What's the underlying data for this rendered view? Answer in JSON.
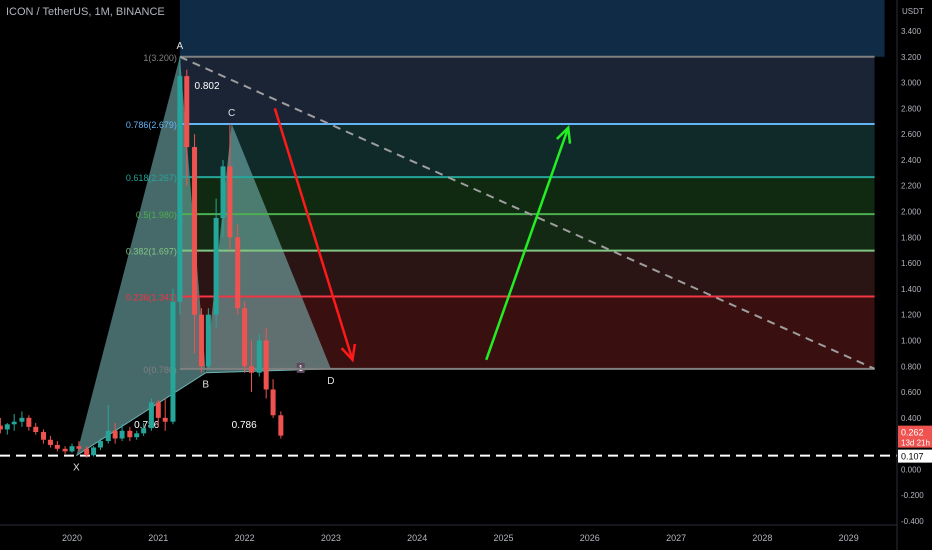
{
  "header": {
    "symbol": "ICON / TetherUS",
    "interval": "1M",
    "exchange": "BINANCE"
  },
  "price_axis": {
    "currency": "USDT",
    "current_price": "0.262",
    "countdown": "13d 21h",
    "dashed_level": "0.107"
  },
  "chart_data": {
    "type": "candlestick",
    "y_ticks": [
      "-0.400",
      "-0.200",
      "0.000",
      "0.200",
      "0.400",
      "0.600",
      "0.800",
      "1.000",
      "1.200",
      "1.400",
      "1.600",
      "1.800",
      "2.000",
      "2.200",
      "2.400",
      "2.600",
      "2.800",
      "3.000",
      "3.200",
      "3.400"
    ],
    "x_ticks": [
      "2020",
      "2021",
      "2022",
      "2023",
      "2024",
      "2025",
      "2026",
      "2027",
      "2028",
      "2029"
    ],
    "ylim": [
      -0.43,
      3.6
    ],
    "x_start": 2019.17,
    "candles": [
      {
        "t": 2019.17,
        "o": 0.34,
        "h": 0.4,
        "l": 0.28,
        "c": 0.31
      },
      {
        "t": 2019.25,
        "o": 0.31,
        "h": 0.36,
        "l": 0.27,
        "c": 0.35
      },
      {
        "t": 2019.33,
        "o": 0.35,
        "h": 0.43,
        "l": 0.3,
        "c": 0.37
      },
      {
        "t": 2019.42,
        "o": 0.37,
        "h": 0.45,
        "l": 0.33,
        "c": 0.4
      },
      {
        "t": 2019.5,
        "o": 0.4,
        "h": 0.42,
        "l": 0.3,
        "c": 0.33
      },
      {
        "t": 2019.58,
        "o": 0.33,
        "h": 0.36,
        "l": 0.27,
        "c": 0.29
      },
      {
        "t": 2019.67,
        "o": 0.29,
        "h": 0.31,
        "l": 0.2,
        "c": 0.23
      },
      {
        "t": 2019.75,
        "o": 0.23,
        "h": 0.26,
        "l": 0.17,
        "c": 0.19
      },
      {
        "t": 2019.83,
        "o": 0.19,
        "h": 0.22,
        "l": 0.14,
        "c": 0.16
      },
      {
        "t": 2019.92,
        "o": 0.16,
        "h": 0.18,
        "l": 0.12,
        "c": 0.14
      },
      {
        "t": 2020.0,
        "o": 0.14,
        "h": 0.2,
        "l": 0.13,
        "c": 0.18
      },
      {
        "t": 2020.08,
        "o": 0.18,
        "h": 0.22,
        "l": 0.14,
        "c": 0.16
      },
      {
        "t": 2020.17,
        "o": 0.16,
        "h": 0.18,
        "l": 0.09,
        "c": 0.11
      },
      {
        "t": 2020.25,
        "o": 0.11,
        "h": 0.18,
        "l": 0.1,
        "c": 0.17
      },
      {
        "t": 2020.33,
        "o": 0.17,
        "h": 0.24,
        "l": 0.15,
        "c": 0.22
      },
      {
        "t": 2020.42,
        "o": 0.22,
        "h": 0.5,
        "l": 0.2,
        "c": 0.3
      },
      {
        "t": 2020.5,
        "o": 0.3,
        "h": 0.36,
        "l": 0.2,
        "c": 0.24
      },
      {
        "t": 2020.58,
        "o": 0.24,
        "h": 0.35,
        "l": 0.22,
        "c": 0.3
      },
      {
        "t": 2020.67,
        "o": 0.3,
        "h": 0.33,
        "l": 0.22,
        "c": 0.25
      },
      {
        "t": 2020.75,
        "o": 0.25,
        "h": 0.3,
        "l": 0.23,
        "c": 0.28
      },
      {
        "t": 2020.83,
        "o": 0.28,
        "h": 0.36,
        "l": 0.26,
        "c": 0.32
      },
      {
        "t": 2020.92,
        "o": 0.32,
        "h": 0.55,
        "l": 0.3,
        "c": 0.52
      },
      {
        "t": 2021.0,
        "o": 0.52,
        "h": 0.54,
        "l": 0.33,
        "c": 0.4
      },
      {
        "t": 2021.08,
        "o": 0.4,
        "h": 0.55,
        "l": 0.3,
        "c": 0.37
      },
      {
        "t": 2021.17,
        "o": 0.37,
        "h": 1.4,
        "l": 0.35,
        "c": 1.3
      },
      {
        "t": 2021.25,
        "o": 1.3,
        "h": 3.2,
        "l": 1.2,
        "c": 3.05
      },
      {
        "t": 2021.33,
        "o": 3.05,
        "h": 3.1,
        "l": 2.2,
        "c": 2.5
      },
      {
        "t": 2021.42,
        "o": 2.5,
        "h": 2.6,
        "l": 0.9,
        "c": 1.2
      },
      {
        "t": 2021.5,
        "o": 1.2,
        "h": 1.25,
        "l": 0.75,
        "c": 0.8
      },
      {
        "t": 2021.58,
        "o": 0.8,
        "h": 1.25,
        "l": 0.78,
        "c": 1.2
      },
      {
        "t": 2021.67,
        "o": 1.2,
        "h": 2.1,
        "l": 1.1,
        "c": 1.95
      },
      {
        "t": 2021.75,
        "o": 1.95,
        "h": 2.4,
        "l": 1.8,
        "c": 2.35
      },
      {
        "t": 2021.83,
        "o": 2.35,
        "h": 2.68,
        "l": 1.7,
        "c": 1.8
      },
      {
        "t": 2021.92,
        "o": 1.8,
        "h": 1.9,
        "l": 1.2,
        "c": 1.25
      },
      {
        "t": 2022.0,
        "o": 1.25,
        "h": 1.3,
        "l": 0.75,
        "c": 0.8
      },
      {
        "t": 2022.08,
        "o": 0.8,
        "h": 1.0,
        "l": 0.6,
        "c": 0.75
      },
      {
        "t": 2022.17,
        "o": 0.75,
        "h": 1.05,
        "l": 0.72,
        "c": 1.0
      },
      {
        "t": 2022.25,
        "o": 1.0,
        "h": 1.1,
        "l": 0.55,
        "c": 0.62
      },
      {
        "t": 2022.33,
        "o": 0.62,
        "h": 0.7,
        "l": 0.4,
        "c": 0.42
      },
      {
        "t": 2022.42,
        "o": 0.42,
        "h": 0.45,
        "l": 0.24,
        "c": 0.262
      }
    ],
    "xabcd": {
      "points": [
        {
          "name": "X",
          "t": 2020.05,
          "v": 0.107
        },
        {
          "name": "A",
          "t": 2021.25,
          "v": 3.2
        },
        {
          "name": "B",
          "t": 2021.55,
          "v": 0.75
        },
        {
          "name": "C",
          "t": 2021.85,
          "v": 2.68
        },
        {
          "name": "D",
          "t": 2023.0,
          "v": 0.78
        }
      ],
      "ratio_xb": "0.786",
      "ratio_ac": "0.802",
      "ratio_bd": "0.786",
      "unreadable_label": "1"
    },
    "fib_levels": [
      {
        "ratio": "1(3.200)",
        "value": 3.2,
        "color": "#808080",
        "fill": "#1c1c1c"
      },
      {
        "ratio": "0.786(2.679)",
        "value": 2.679,
        "color": "#64b5f6",
        "fill": "#1a2434"
      },
      {
        "ratio": "0.618(2.267)",
        "value": 2.267,
        "color": "#26a69a",
        "fill": "#102a2a"
      },
      {
        "ratio": "0.5(1.980)",
        "value": 1.98,
        "color": "#4caf50",
        "fill": "#0f2a10"
      },
      {
        "ratio": "0.382(1.697)",
        "value": 1.697,
        "color": "#81c784",
        "fill": "#132914"
      },
      {
        "ratio": "0.236(1.341)",
        "value": 1.341,
        "color": "#f23645",
        "fill": "#2a1414"
      },
      {
        "ratio": "0(0.780)",
        "value": 0.78,
        "color": "#808080",
        "fill": "#3a0f0f"
      }
    ],
    "fib_x_start": 2021.25,
    "right_edge_t": 2029.3,
    "trendline": {
      "t1": 2021.25,
      "v1": 3.2,
      "t2": 2029.3,
      "v2": 0.78
    },
    "arrows": [
      {
        "t1": 2022.35,
        "v1": 2.8,
        "t2": 2023.25,
        "v2": 0.85,
        "color": "#ff1a1a"
      },
      {
        "t1": 2024.8,
        "v1": 0.85,
        "t2": 2025.75,
        "v2": 2.65,
        "color": "#22ee22"
      }
    ],
    "horizontal_dashed": 0.107,
    "colors": {
      "up": "#26a69a",
      "down": "#ef5350",
      "fib_top_fill": "#0f2b45",
      "pattern_fill": "#7fbfbf"
    }
  }
}
